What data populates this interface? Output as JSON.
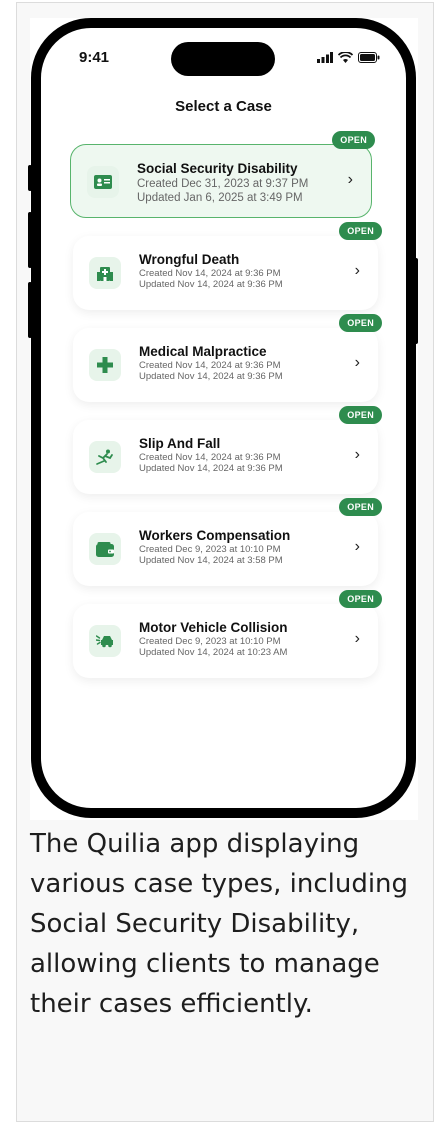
{
  "status_bar": {
    "time": "9:41"
  },
  "screen": {
    "title": "Select a Case"
  },
  "cases": [
    {
      "title": "Social Security Disability",
      "created": "Created Dec 31, 2023 at 9:37 PM",
      "updated": "Updated Jan 6, 2025 at 3:49 PM",
      "badge": "OPEN",
      "icon": "id-card-icon"
    },
    {
      "title": "Wrongful Death",
      "created": "Created Nov 14, 2024 at 9:36 PM",
      "updated": "Updated Nov 14, 2024 at 9:36 PM",
      "badge": "OPEN",
      "icon": "hospital-icon"
    },
    {
      "title": "Medical Malpractice",
      "created": "Created Nov 14, 2024 at 9:36 PM",
      "updated": "Updated Nov 14, 2024 at 9:36 PM",
      "badge": "OPEN",
      "icon": "medical-cross-icon"
    },
    {
      "title": "Slip And Fall",
      "created": "Created Nov 14, 2024 at 9:36 PM",
      "updated": "Updated Nov 14, 2024 at 9:36 PM",
      "badge": "OPEN",
      "icon": "slip-icon"
    },
    {
      "title": "Workers Compensation",
      "created": "Created Dec 9, 2023 at 10:10 PM",
      "updated": "Updated Nov 14, 2024 at 3:58 PM",
      "badge": "OPEN",
      "icon": "wallet-icon"
    },
    {
      "title": "Motor Vehicle Collision",
      "created": "Created Dec 9, 2023 at 10:10 PM",
      "updated": "Updated Nov 14, 2024 at 10:23 AM",
      "badge": "OPEN",
      "icon": "car-crash-icon"
    }
  ],
  "caption": "The Quilia app displaying various case types, including Social Security Disability, allowing clients to manage their cases efficiently.",
  "colors": {
    "accent": "#2e8c4e",
    "selected_bg": "#eef8f0",
    "selected_border": "#58b46c",
    "icon_bg": "#e7f4ea"
  }
}
